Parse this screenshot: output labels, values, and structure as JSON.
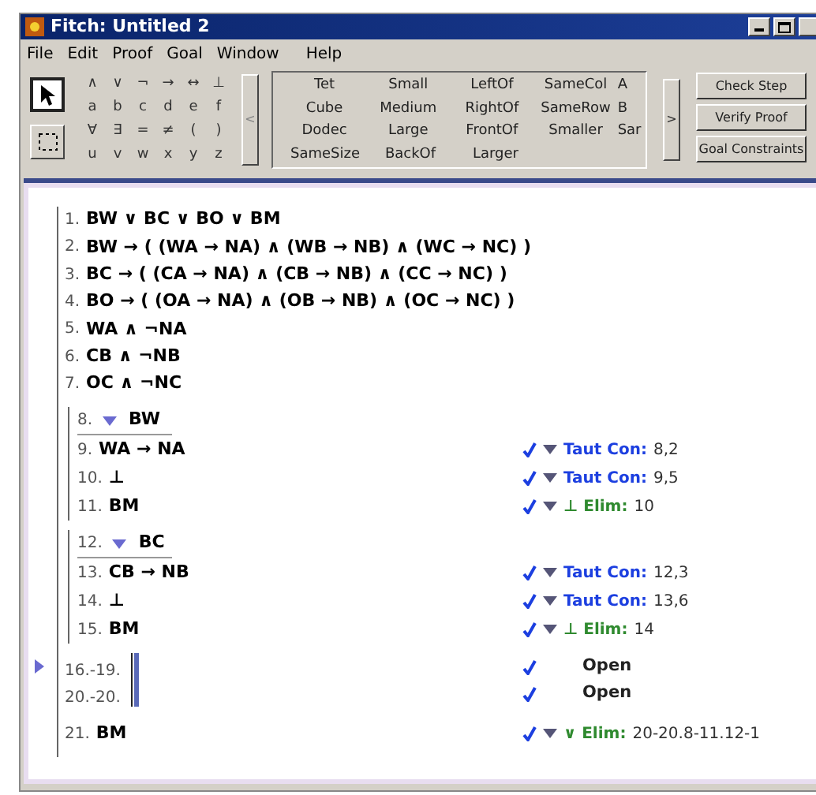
{
  "window": {
    "title": "Fitch: Untitled 2"
  },
  "menu": [
    "File",
    "Edit",
    "Proof",
    "Goal",
    "Window",
    "Help"
  ],
  "toolbar": {
    "tools": [
      {
        "kind": "pointer",
        "selected": true
      },
      {
        "kind": "marquee",
        "selected": false
      }
    ],
    "symbols": [
      [
        "∧",
        "∨",
        "¬",
        "→",
        "↔",
        "⊥"
      ],
      [
        "a",
        "b",
        "c",
        "d",
        "e",
        "f"
      ],
      [
        "∀",
        "∃",
        "=",
        "≠",
        "(",
        ")"
      ],
      [
        "u",
        "v",
        "w",
        "x",
        "y",
        "z"
      ]
    ],
    "scroll_left": "<",
    "predicates": [
      [
        "Tet",
        "Small",
        "LeftOf",
        "SameCol",
        "A"
      ],
      [
        "Cube",
        "Medium",
        "RightOf",
        "SameRow",
        "B"
      ],
      [
        "Dodec",
        "Large",
        "FrontOf",
        "Smaller",
        "Sar"
      ],
      [
        "SameSize",
        "BackOf",
        "Larger"
      ]
    ],
    "scroll_right": ">",
    "buttons": [
      "Check Step",
      "Verify Proof",
      "Goal Constraints"
    ]
  },
  "proof": {
    "premises": [
      {
        "number": "1.",
        "formula": "BW ∨ BC ∨ BO ∨ BM"
      },
      {
        "number": "2.",
        "formula": "BW → ( (WA → NA) ∧ (WB → NB) ∧ (WC → NC) )"
      },
      {
        "number": "3.",
        "formula": "BC → ( (CA → NA) ∧ (CB → NB) ∧ (CC → NC) )"
      },
      {
        "number": "4.",
        "formula": "BO → ( (OA → NA) ∧ (OB → NB) ∧ (OC → NC) )"
      },
      {
        "number": "5.",
        "formula": "WA ∧ ¬NA"
      },
      {
        "number": "6.",
        "formula": "CB ∧ ¬NB"
      },
      {
        "number": "7.",
        "formula": "OC ∧ ¬NC"
      }
    ],
    "steps": [
      {
        "kind": "subproof",
        "assumption": {
          "number": "8.",
          "formula": "BW"
        },
        "lines": [
          {
            "number": "9.",
            "formula": "WA → NA",
            "checked": true,
            "rule": "Taut Con:",
            "color": "#1c3fe0",
            "citation": "8,2"
          },
          {
            "number": "10.",
            "formula": "⊥",
            "checked": true,
            "rule": "Taut Con:",
            "color": "#1c3fe0",
            "citation": "9,5"
          },
          {
            "number": "11.",
            "formula": "BM",
            "checked": true,
            "rule": "⊥ Elim:",
            "color": "#2f8a2f",
            "citation": "10"
          }
        ]
      },
      {
        "kind": "subproof",
        "assumption": {
          "number": "12.",
          "formula": "BC"
        },
        "lines": [
          {
            "number": "13.",
            "formula": "CB → NB",
            "checked": true,
            "rule": "Taut Con:",
            "color": "#1c3fe0",
            "citation": "12,3"
          },
          {
            "number": "14.",
            "formula": "⊥",
            "checked": true,
            "rule": "Taut Con:",
            "color": "#1c3fe0",
            "citation": "13,6"
          },
          {
            "number": "15.",
            "formula": "BM",
            "checked": true,
            "rule": "⊥ Elim:",
            "color": "#2f8a2f",
            "citation": "14"
          }
        ]
      },
      {
        "kind": "collapsed",
        "number": "16.-19.",
        "status": "Open",
        "checked": true,
        "focused": true
      },
      {
        "kind": "collapsed",
        "number": "20.-20.",
        "status": "Open",
        "checked": true,
        "focused": false
      },
      {
        "kind": "line",
        "number": "21.",
        "formula": "BM",
        "checked": true,
        "rule": "∨ Elim:",
        "color": "#2f8a2f",
        "citation": "20-20.8-11.12-1"
      }
    ]
  }
}
